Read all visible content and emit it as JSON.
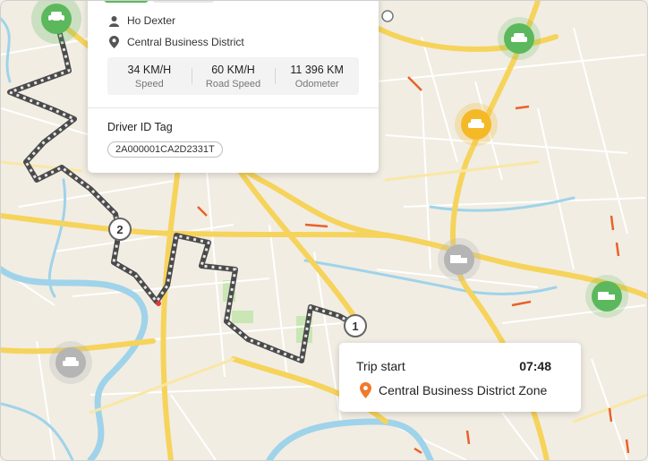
{
  "driver_card": {
    "driver_name": "Ho Dexter",
    "location": "Central Business District",
    "stats": [
      {
        "value": "34 KM/H",
        "label": "Speed"
      },
      {
        "value": "60 KM/H",
        "label": "Road Speed"
      },
      {
        "value": "11 396 KM",
        "label": "Odometer"
      }
    ],
    "tag_title": "Driver ID Tag",
    "tag_value": "2A000001CA2D2331T"
  },
  "trip_card": {
    "title": "Trip start",
    "time": "07:48",
    "location": "Central Business District Zone"
  },
  "waypoints": [
    {
      "label": "1"
    },
    {
      "label": "2"
    }
  ],
  "vehicle_markers": [
    {
      "icon": "car-icon",
      "status": "active",
      "color": "#5cb85c"
    },
    {
      "icon": "car-icon",
      "status": "active",
      "color": "#5cb85c"
    },
    {
      "icon": "car-icon",
      "status": "idle",
      "color": "#f5b928"
    },
    {
      "icon": "truck-icon",
      "status": "offline",
      "color": "#b5b5b5"
    },
    {
      "icon": "truck-icon",
      "status": "active",
      "color": "#5cb85c"
    },
    {
      "icon": "car-icon",
      "status": "offline",
      "color": "#b5b5b5"
    }
  ],
  "colors": {
    "route": "#4a4a4a",
    "major_road": "#f6d35b",
    "minor_road": "#ffffff",
    "water": "#9fd3ea",
    "park": "#c9e6b4",
    "pin": "#f07a2b",
    "traffic": "#e8622a"
  }
}
